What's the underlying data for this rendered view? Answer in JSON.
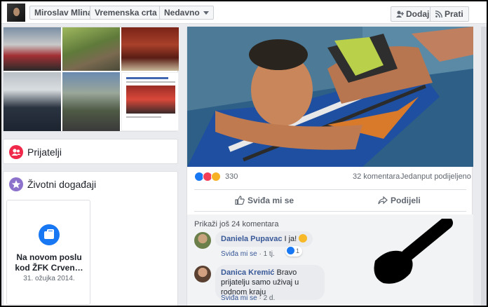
{
  "topbar": {
    "profile_name": "Miroslav Mlinar",
    "timeline_label": "Vremenska crta",
    "recent_label": "Nedavno",
    "add_label": "Dodaj",
    "follow_label": "Prati"
  },
  "friends": {
    "title": "Prijatelji"
  },
  "life_events": {
    "title": "Životni događaji",
    "event_title": "Na novom poslu kod ŽFK Crven…",
    "event_date": "31. ožujka 2014."
  },
  "post": {
    "reaction_count": "330",
    "comments_count": "32 komentara",
    "shares": "Jedanput podijeljeno",
    "like_label": "Sviđa mi se",
    "share_label": "Podijeli",
    "more_comments": "Prikaži još 24 komentara"
  },
  "comments": [
    {
      "name": "Daniela Pupavac",
      "text": "I ja!",
      "like": "Sviđa mi se",
      "time": "1 tj.",
      "reactions": "1"
    },
    {
      "name": "Danica Kremić",
      "text": "Bravo prijatelju samo uživaj u rodnom kraju",
      "like": "Sviđa mi se",
      "time": "2 d."
    }
  ],
  "colors": {
    "accent": "#1877f2",
    "link": "#385898",
    "friends_icon": "#f02849",
    "events_icon": "#8c72cb"
  },
  "icons": [
    "add-friend-icon",
    "rss-icon",
    "friends-icon",
    "star-icon",
    "briefcase-icon",
    "like-icon",
    "share-icon",
    "smiley-icon"
  ]
}
